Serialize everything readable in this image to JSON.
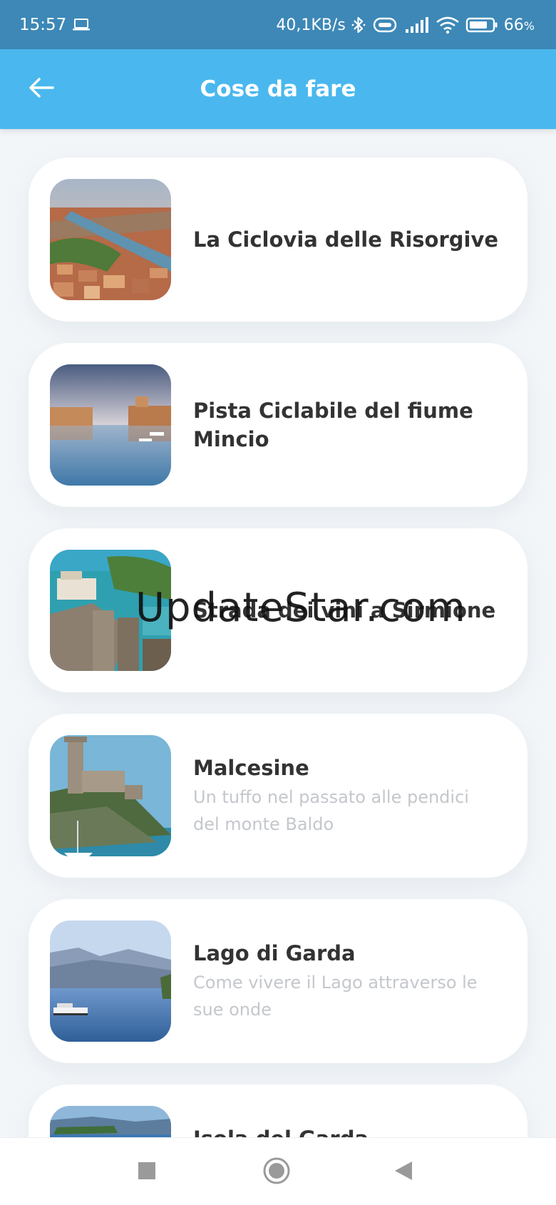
{
  "status_bar": {
    "time": "15:57",
    "network_speed": "40,1KB/s",
    "battery_percent": "66",
    "battery_suffix": "%",
    "icons": [
      "laptop-icon",
      "bluetooth-icon",
      "vibrate-icon",
      "signal-icon",
      "wifi-icon",
      "battery-icon"
    ]
  },
  "header": {
    "title": "Cose da fare",
    "back_icon": "back-arrow-icon",
    "background_color": "#4ab8ee"
  },
  "cards": [
    {
      "title": "La Ciclovia delle Risorgive",
      "subtitle": "",
      "image": "city-river-photo"
    },
    {
      "title": "Pista Ciclabile del fiume Mincio",
      "subtitle": "",
      "image": "canal-town-photo"
    },
    {
      "title": "Strada dei vini a Sirmione",
      "subtitle": "",
      "image": "castle-lake-photo"
    },
    {
      "title": "Malcesine",
      "subtitle": "Un tuffo nel passato alle pendici del monte Baldo",
      "image": "cliff-castle-photo"
    },
    {
      "title": "Lago di Garda",
      "subtitle": "Come vivere il Lago attraverso le sue onde",
      "image": "lake-mountains-photo"
    },
    {
      "title": "Isola del Garda",
      "subtitle": "",
      "image": "island-photo"
    }
  ],
  "watermark": "UpdateStar.com",
  "nav_bar": {
    "icons": [
      "recents-square-icon",
      "home-circle-icon",
      "back-triangle-icon"
    ]
  },
  "colors": {
    "status_bar": "#3d88b7",
    "title_text": "#333333",
    "subtitle_text": "#c4c7cc"
  }
}
